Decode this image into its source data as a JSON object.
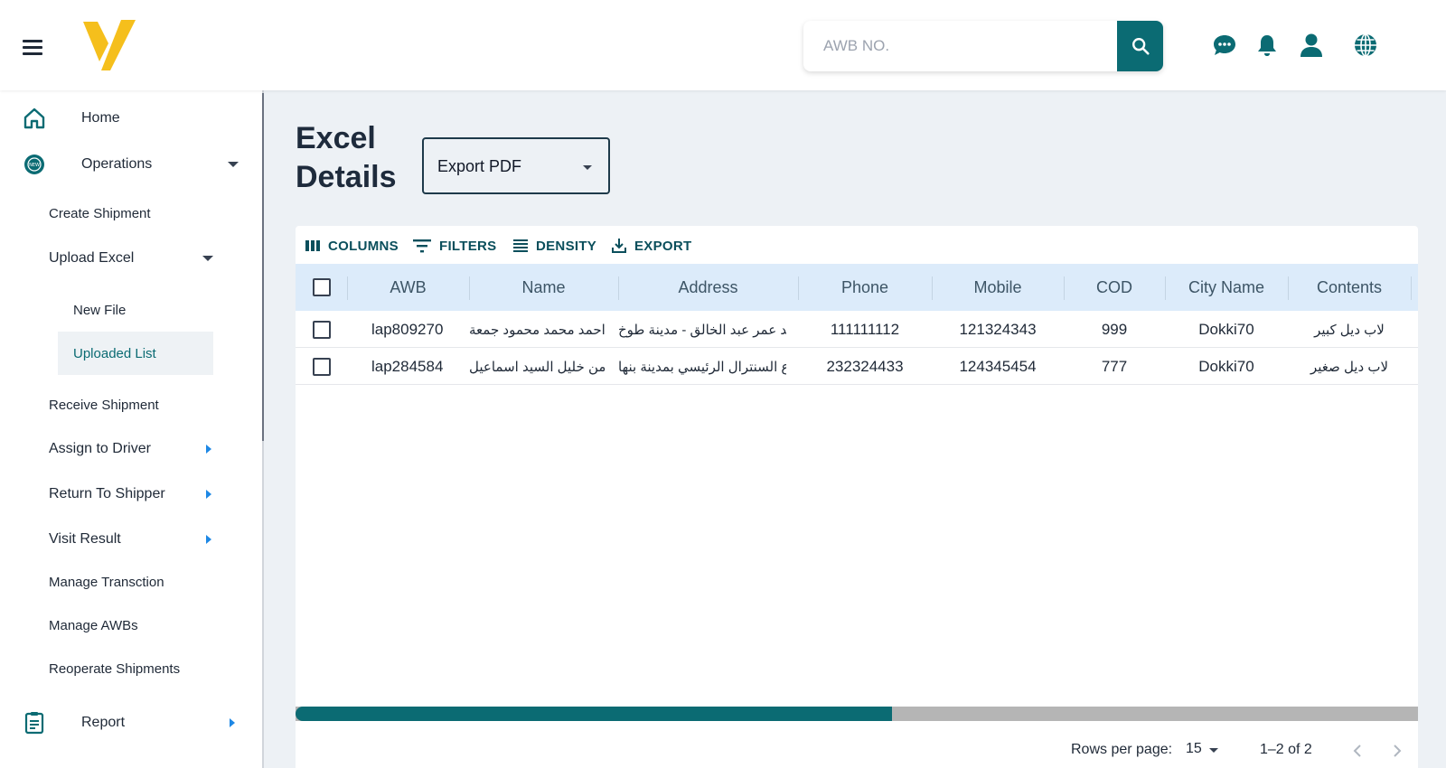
{
  "header": {
    "search_placeholder": "AWB NO.",
    "icons": [
      "menu-icon",
      "logo",
      "search-icon",
      "chat-icon",
      "bell-icon",
      "user-icon",
      "globe-icon"
    ]
  },
  "sidebar": {
    "home": "Home",
    "operations": "Operations",
    "create_shipment": "Create Shipment",
    "upload_excel": "Upload Excel",
    "new_file": "New File",
    "uploaded_list": "Uploaded List",
    "receive_shipment": "Receive Shipment",
    "assign_driver": "Assign to Driver",
    "return_shipper": "Return To Shipper",
    "visit_result": "Visit Result",
    "manage_transction": "Manage Transction",
    "manage_awbs": "Manage AWBs",
    "reoperate": "Reoperate Shipments",
    "report": "Report"
  },
  "main": {
    "title": "Excel Details",
    "export_value": "Export PDF"
  },
  "toolbar": {
    "columns": "COLUMNS",
    "filters": "FILTERS",
    "density": "DENSITY",
    "export": "EXPORT"
  },
  "table": {
    "headers": [
      "AWB",
      "Name",
      "Address",
      "Phone",
      "Mobile",
      "COD",
      "City Name",
      "Contents"
    ],
    "rows": [
      {
        "awb": "lap809270",
        "name": "احمد محمد محمود جمعة",
        "address": "...يد عمر عبد الخالق - مدينة طوخ",
        "phone": "111111112",
        "mobile": "121324343",
        "cod": "999",
        "city": "Dokki70",
        "contents": "لاب ديل كبير"
      },
      {
        "awb": "lap284584",
        "name": "...من خليل السيد اسماعيل",
        "address": "...ع السنترال الرئيسي بمدينة بنها",
        "phone": "232324433",
        "mobile": "124345454",
        "cod": "777",
        "city": "Dokki70",
        "contents": "لاب ديل صغير"
      }
    ]
  },
  "footer": {
    "rows_label": "Rows per page:",
    "rows_value": "15",
    "range": "1–2 of 2"
  },
  "colors": {
    "accent": "#0b6b73",
    "logo": "#f5bf1c",
    "header_row": "#dcebfa"
  }
}
